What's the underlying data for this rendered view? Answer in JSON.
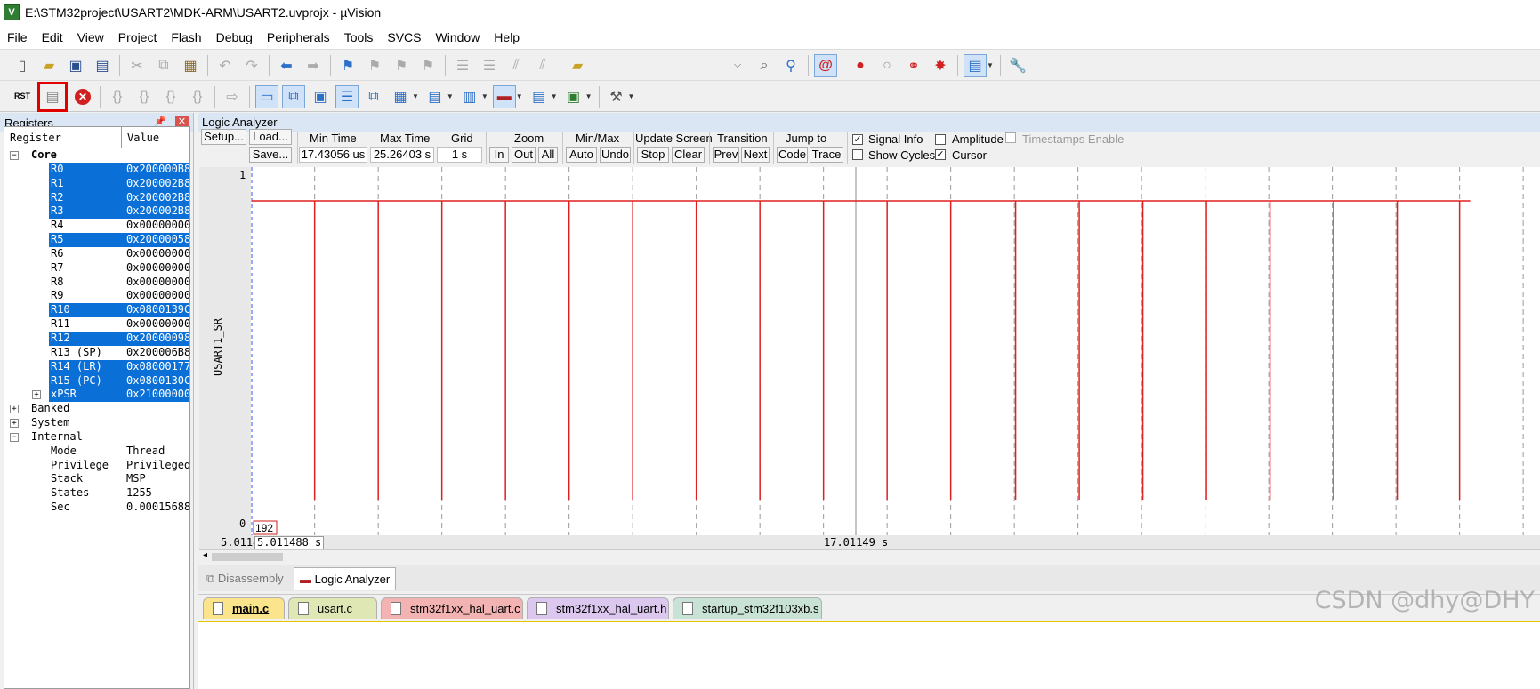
{
  "window": {
    "title": "E:\\STM32project\\USART2\\MDK-ARM\\USART2.uvprojx - µVision"
  },
  "menu": [
    "File",
    "Edit",
    "View",
    "Project",
    "Flash",
    "Debug",
    "Peripherals",
    "Tools",
    "SVCS",
    "Window",
    "Help"
  ],
  "toolbar2": {
    "rst_label": "RST"
  },
  "registers": {
    "title": "Registers",
    "col_register": "Register",
    "col_value": "Value",
    "core_label": "Core",
    "rows": [
      {
        "name": "R0",
        "value": "0x200000B8",
        "selected": true
      },
      {
        "name": "R1",
        "value": "0x200002B8",
        "selected": true
      },
      {
        "name": "R2",
        "value": "0x200002B8",
        "selected": true
      },
      {
        "name": "R3",
        "value": "0x200002B8",
        "selected": true
      },
      {
        "name": "R4",
        "value": "0x00000000",
        "selected": false
      },
      {
        "name": "R5",
        "value": "0x20000058",
        "selected": true
      },
      {
        "name": "R6",
        "value": "0x00000000",
        "selected": false
      },
      {
        "name": "R7",
        "value": "0x00000000",
        "selected": false
      },
      {
        "name": "R8",
        "value": "0x00000000",
        "selected": false
      },
      {
        "name": "R9",
        "value": "0x00000000",
        "selected": false
      },
      {
        "name": "R10",
        "value": "0x0800139C",
        "selected": true
      },
      {
        "name": "R11",
        "value": "0x00000000",
        "selected": false
      },
      {
        "name": "R12",
        "value": "0x20000098",
        "selected": true
      },
      {
        "name": "R13 (SP)",
        "value": "0x200006B8",
        "selected": false
      },
      {
        "name": "R14 (LR)",
        "value": "0x08000177",
        "selected": true
      },
      {
        "name": "R15 (PC)",
        "value": "0x0800130C",
        "selected": true
      },
      {
        "name": "xPSR",
        "value": "0x21000000",
        "selected": true
      }
    ],
    "groups": [
      "Banked",
      "System",
      "Internal"
    ],
    "internal": [
      {
        "name": "Mode",
        "value": "Thread"
      },
      {
        "name": "Privilege",
        "value": "Privileged"
      },
      {
        "name": "Stack",
        "value": "MSP"
      },
      {
        "name": "States",
        "value": "1255"
      },
      {
        "name": "Sec",
        "value": "0.00015688"
      }
    ]
  },
  "logic": {
    "title": "Logic Analyzer",
    "setup": "Setup...",
    "load": "Load...",
    "save": "Save...",
    "min_time_label": "Min Time",
    "min_time": "17.43056 us",
    "max_time_label": "Max Time",
    "max_time": "25.26403 s",
    "grid_label": "Grid",
    "grid": "1 s",
    "zoom_label": "Zoom",
    "zoom_in": "In",
    "zoom_out": "Out",
    "zoom_all": "All",
    "minmax_label": "Min/Max",
    "auto": "Auto",
    "undo": "Undo",
    "update_label": "Update Screen",
    "stop": "Stop",
    "clear": "Clear",
    "transition_label": "Transition",
    "prev": "Prev",
    "next": "Next",
    "jump_label": "Jump to",
    "code": "Code",
    "trace": "Trace",
    "signal_info": "Signal Info",
    "amplitude": "Amplitude",
    "timestamps": "Timestamps Enable",
    "show_cycles": "Show Cycles",
    "cursor": "Cursor",
    "signal_name": "USART1_SR",
    "y_max": "1",
    "y_min": "0",
    "marker_value": "192",
    "time_left": "5.0114",
    "time_cursor": "5.011488 s",
    "time_right": "17.01149 s"
  },
  "chart_data": {
    "type": "line",
    "title": "",
    "ylabel": "USART1_SR",
    "ylim": [
      0,
      1
    ],
    "xlim": [
      5.011488,
      25.26403
    ],
    "grid_step": 1,
    "series": [
      {
        "name": "USART1_SR",
        "baseline": 1,
        "pulse_low_x": [
          6.0,
          7.0,
          8.0,
          9.0,
          10.0,
          11.0,
          12.0,
          13.0,
          14.0,
          15.0,
          16.0,
          17.02,
          18.02,
          19.02,
          20.02,
          21.02,
          22.02,
          23.02,
          24.0
        ]
      }
    ],
    "signal_color": "#e02020"
  },
  "view_tabs": [
    "Disassembly",
    "Logic Analyzer"
  ],
  "file_tabs": [
    {
      "label": "main.c",
      "color": "#fbe58c",
      "active": true
    },
    {
      "label": "usart.c",
      "color": "#dfe8b4",
      "active": false
    },
    {
      "label": "stm32f1xx_hal_uart.c",
      "color": "#f3b3b3",
      "active": false
    },
    {
      "label": "stm32f1xx_hal_uart.h",
      "color": "#dcc8ef",
      "active": false
    },
    {
      "label": "startup_stm32f103xb.s",
      "color": "#c9e2d6",
      "active": false
    }
  ],
  "watermark": "CSDN @dhy@DHY"
}
